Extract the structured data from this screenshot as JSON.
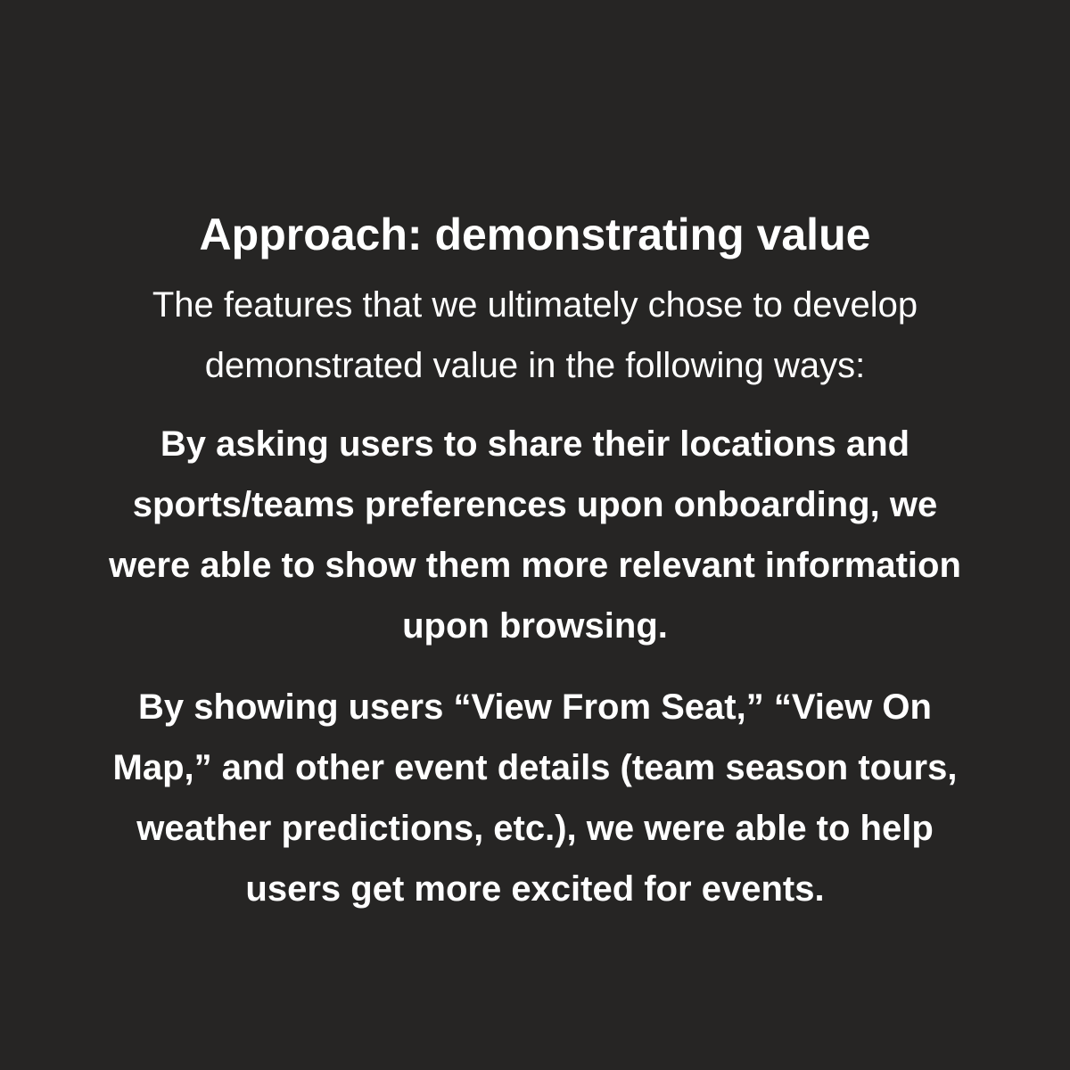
{
  "slide": {
    "title": "Approach: demonstrating value",
    "intro": "The features that we ultimately chose to develop demonstrated value in the following ways:",
    "points": [
      "By asking users to share their locations and sports/teams preferences upon onboarding, we were able to show them more relevant information upon browsing.",
      "By showing users “View From Seat,” “View On Map,” and other event details (team season tours, weather predictions, etc.), we were able to help users get more excited for events."
    ]
  },
  "colors": {
    "background": "#262524",
    "text": "#ffffff"
  }
}
